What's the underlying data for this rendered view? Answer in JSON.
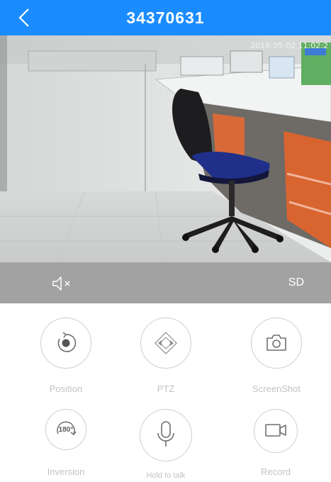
{
  "header": {
    "title": "34370631",
    "back_icon": "chevron-left-icon",
    "color": "#1a8cff"
  },
  "video": {
    "timestamp": "2018-05-02  11:02:2"
  },
  "controls": {
    "mute_icon": "speaker-muted-icon",
    "quality_label": "SD"
  },
  "actions": [
    {
      "label": "Position",
      "icon": "position-icon"
    },
    {
      "label": "PTZ",
      "icon": "ptz-icon"
    },
    {
      "label": "ScreenShot",
      "icon": "camera-icon"
    },
    {
      "label": "Inversion",
      "icon": "rotate-180-icon",
      "icon_text": "180°"
    },
    {
      "label": "Hold to talk",
      "icon": "microphone-icon"
    },
    {
      "label": "Record",
      "icon": "video-camera-icon"
    }
  ]
}
